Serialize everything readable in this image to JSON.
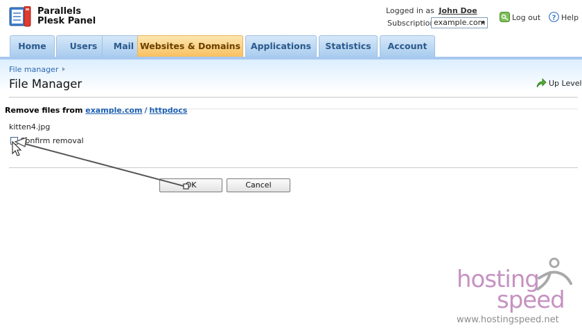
{
  "brand": {
    "line1": "Parallels",
    "line2": "Plesk Panel"
  },
  "header": {
    "logged_in_as": "Logged in as",
    "user_name": "John Doe",
    "subscription_label": "Subscription",
    "subscription_value": "example.com",
    "logout_label": "Log out",
    "help_label": "Help"
  },
  "tabs": [
    {
      "label": "Home",
      "active": false
    },
    {
      "label": "Users",
      "active": false
    },
    {
      "label": "Mail",
      "active": false
    },
    {
      "label": "Websites & Domains",
      "active": true
    },
    {
      "label": "Applications",
      "active": false
    },
    {
      "label": "Statistics",
      "active": false
    },
    {
      "label": "Account",
      "active": false
    }
  ],
  "breadcrumb": {
    "item": "File manager"
  },
  "page": {
    "title": "File Manager",
    "up_level_label": "Up Level"
  },
  "form": {
    "remove_prefix": "Remove files from",
    "domain_link": "example.com",
    "separator": "/",
    "folder_link": "httpdocs",
    "file_name": "kitten4.jpg",
    "confirm_label": "Confirm removal",
    "confirm_checked": false,
    "ok_label": "OK",
    "cancel_label": "Cancel"
  },
  "watermark": {
    "word1": "hosting",
    "word2": "speed",
    "url": "www.hostingspeed.net"
  },
  "colors": {
    "tab_inactive": "#a9ccef",
    "tab_active": "#f8c05f",
    "link": "#1b5eb0",
    "watermark": "#c692c1"
  }
}
